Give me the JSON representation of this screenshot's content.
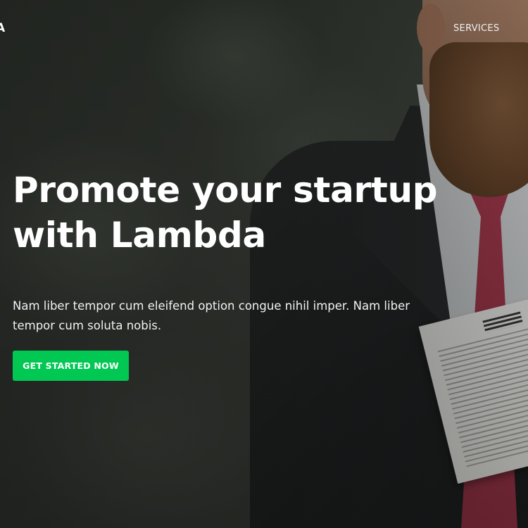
{
  "nav": {
    "brand": "A",
    "links": [
      {
        "label": "SERVICES"
      }
    ]
  },
  "hero": {
    "headline": "Promote your startup with Lambda",
    "description": "Nam liber tempor cum eleifend option congue nihil imper. Nam liber tempor cum soluta nobis.",
    "cta_label": "GET STARTED NOW"
  },
  "colors": {
    "cta_background": "#00c853",
    "text": "#ffffff",
    "overlay": "#0f110f"
  }
}
